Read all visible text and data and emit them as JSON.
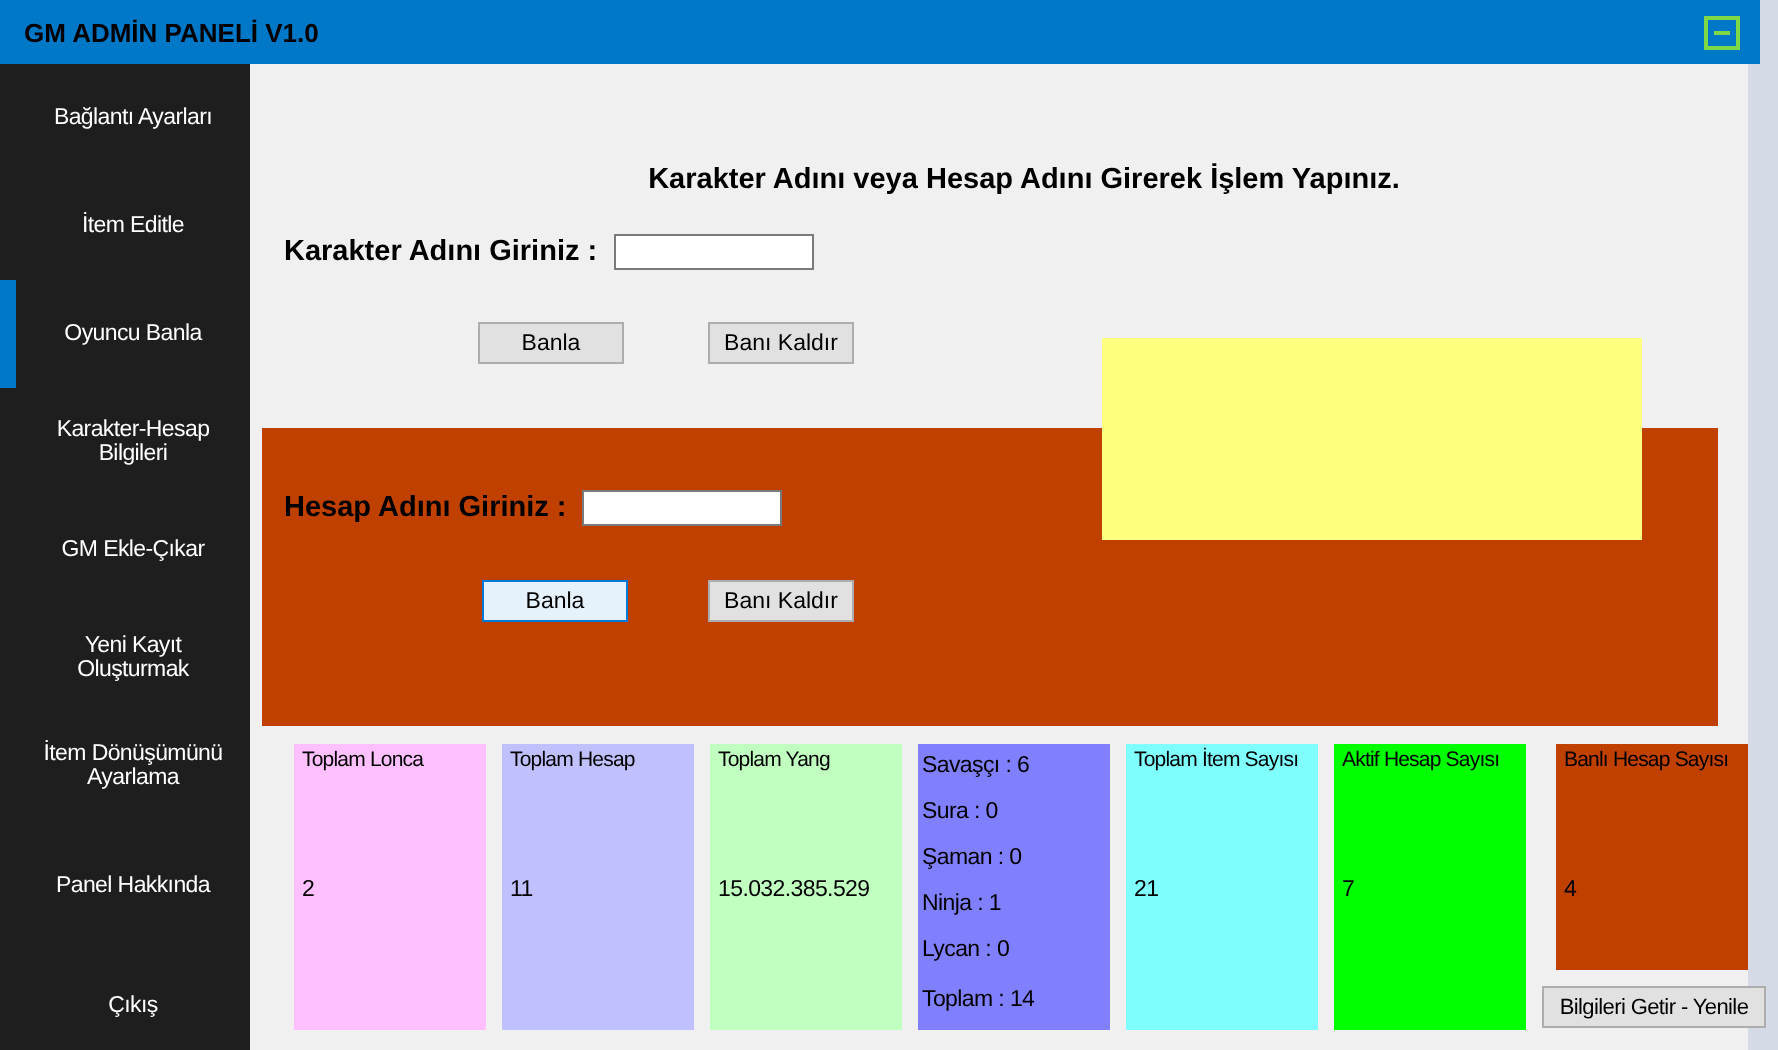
{
  "window": {
    "title": "GM ADMİN PANELİ  V1.0"
  },
  "sidebar": {
    "items": [
      {
        "label": "Bağlantı Ayarları",
        "selected": false
      },
      {
        "label": "İtem Editle",
        "selected": false
      },
      {
        "label": "Oyuncu Banla",
        "selected": true
      },
      {
        "label": "Karakter-Hesap Bilgileri",
        "selected": false
      },
      {
        "label": "GM Ekle-Çıkar",
        "selected": false
      },
      {
        "label": "Yeni Kayıt Oluşturmak",
        "selected": false
      },
      {
        "label": "İtem Dönüşümünü Ayarlama",
        "selected": false
      },
      {
        "label": "Panel Hakkında",
        "selected": false
      },
      {
        "label": "Çıkış",
        "selected": false
      }
    ]
  },
  "heading": "Karakter Adını veya Hesap Adını Girerek İşlem Yapınız.",
  "character_form": {
    "label": "Karakter Adını Giriniz :",
    "ban_button": "Banla",
    "unban_button": "Banı Kaldır"
  },
  "account_form": {
    "label": "Hesap Adını Giriniz :",
    "ban_button": "Banla",
    "unban_button": "Banı Kaldır"
  },
  "stats": [
    {
      "kind": "stat",
      "title": "Toplam Lonca",
      "value": "2",
      "color": "#ffc0ff"
    },
    {
      "kind": "stat",
      "title": "Toplam Hesap",
      "value": "11",
      "color": "#c0c0ff"
    },
    {
      "kind": "stat",
      "title": "Toplam Yang",
      "value": "15.032.385.529",
      "color": "#c0ffc0"
    },
    {
      "kind": "breakdown",
      "lines": [
        "Savaşçı : 6",
        "Sura :  0",
        "Şaman :  0",
        "Ninja : 1",
        "Lycan : 0"
      ],
      "total": "Toplam :  14",
      "color": "#8080ff"
    },
    {
      "kind": "stat",
      "title": "Toplam İtem Sayısı",
      "value": "21",
      "color": "#80ffff"
    },
    {
      "kind": "stat",
      "title": "Aktif Hesap Sayısı",
      "value": "7",
      "color": "#00ff00"
    },
    {
      "kind": "short",
      "title": "Banlı Hesap Sayısı",
      "value": "4",
      "color": "#c04000"
    }
  ],
  "refresh_button": "Bilgileri Getir - Yenile"
}
